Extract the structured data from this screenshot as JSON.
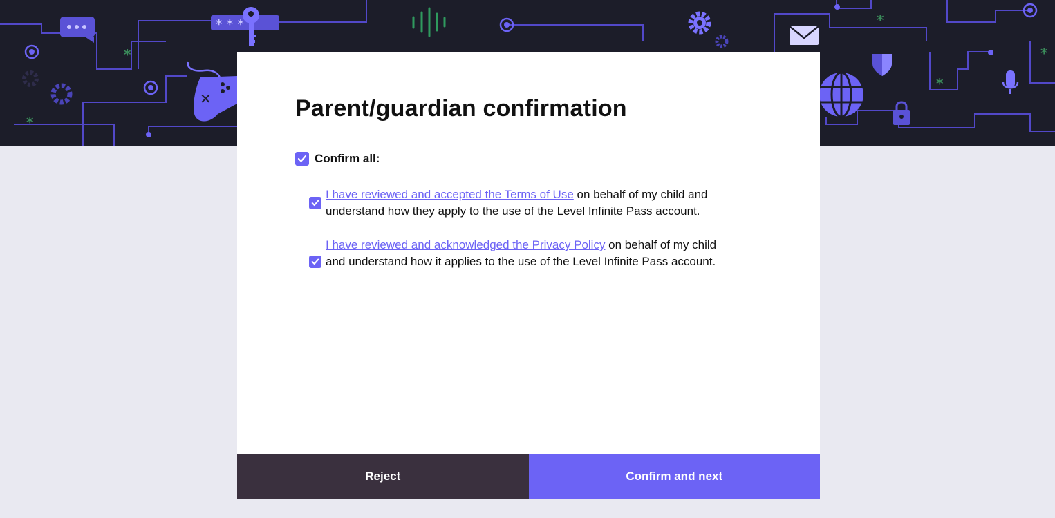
{
  "colors": {
    "accent": "#6c63f5",
    "banner_bg": "#1c1d29",
    "page_bg": "#e9e9f1",
    "reject_bg": "#3a303e"
  },
  "banner": {
    "icons": [
      "chat-bubble-icon",
      "password-key-icon",
      "audio-waveform-icon",
      "gear-icon",
      "game-controller-icon",
      "envelope-icon",
      "shield-icon",
      "globe-icon",
      "lock-icon",
      "microphone-icon"
    ]
  },
  "dialog": {
    "title": "Parent/guardian confirmation",
    "confirm_all": {
      "label": "Confirm all:",
      "checked": true
    },
    "items": [
      {
        "link_text": "I have reviewed and accepted the Terms of Use",
        "rest_text": " on behalf of my child and understand how they apply to the use of the Level Infinite Pass account.",
        "checked": true
      },
      {
        "link_text": "I have reviewed and acknowledged the Privacy Policy",
        "rest_text": " on behalf of my child and understand how it applies to the use of the Level Infinite Pass account.",
        "checked": true
      }
    ]
  },
  "buttons": {
    "reject_label": "Reject",
    "confirm_label": "Confirm and next"
  }
}
